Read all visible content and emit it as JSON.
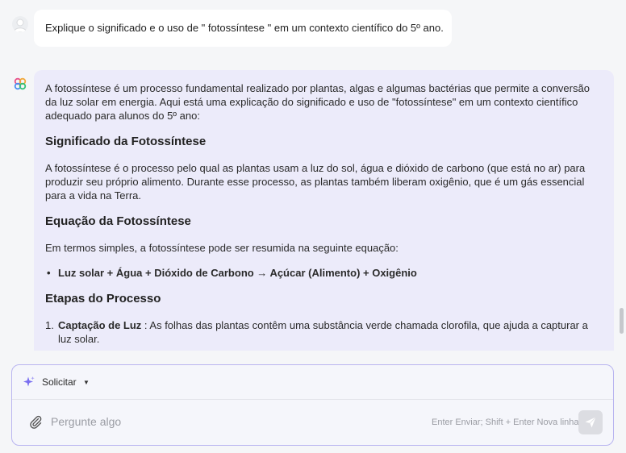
{
  "user_message": "Explique o significado e o uso de \" fotossíntese \" em um contexto científico do 5º ano.",
  "assistant": {
    "intro": "A fotossíntese é um processo fundamental realizado por plantas, algas e algumas bactérias que permite a conversão da luz solar em energia. Aqui está uma explicação do significado e uso de \"fotossíntese\" em um contexto científico adequado para alunos do 5º ano:",
    "heading_meaning": "Significado da Fotossíntese",
    "meaning_text": "A fotossíntese é o processo pelo qual as plantas usam a luz do sol, água e dióxido de carbono (que está no ar) para produzir seu próprio alimento. Durante esse processo, as plantas também liberam oxigênio, que é um gás essencial para a vida na Terra.",
    "heading_equation": "Equação da Fotossíntese",
    "equation_intro": "Em termos simples, a fotossíntese pode ser resumida na seguinte equação:",
    "equation": "Luz solar + Água + Dióxido de Carbono → Açúcar (Alimento) + Oxigênio",
    "heading_steps": "Etapas do Processo",
    "steps": [
      {
        "number": "1.",
        "title": "Captação de Luz",
        "text": " : As folhas das plantas contêm uma substância verde chamada clorofila, que ajuda a capturar a luz solar."
      }
    ]
  },
  "composer": {
    "mode_label": "Solicitar",
    "placeholder": "Pergunte algo",
    "hint": "Enter Enviar; Shift + Enter Nova linha"
  },
  "icons": {
    "user_avatar": "user-avatar-icon",
    "bot_avatar": "assistant-logo-icon",
    "sparkle": "sparkle-icon",
    "attach": "paperclip-icon",
    "send": "send-icon"
  },
  "colors": {
    "assistant_bubble": "#ecebfa",
    "composer_border": "#b9b5f0",
    "accent": "#7a6ff0"
  }
}
